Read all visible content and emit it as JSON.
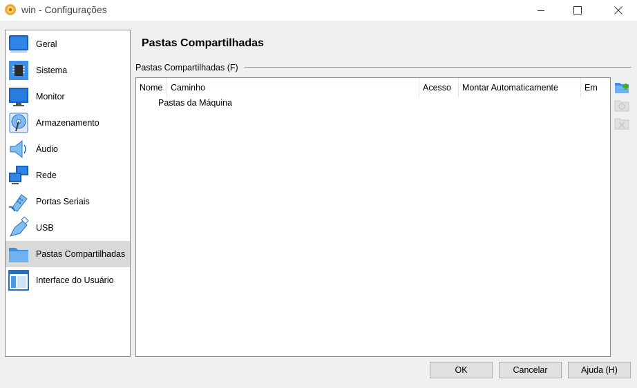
{
  "window": {
    "title": "win - Configurações"
  },
  "sidebar": {
    "items": [
      {
        "label": "Geral",
        "icon": "general-icon"
      },
      {
        "label": "Sistema",
        "icon": "system-chip-icon"
      },
      {
        "label": "Monitor",
        "icon": "monitor-icon"
      },
      {
        "label": "Armazenamento",
        "icon": "storage-disk-icon"
      },
      {
        "label": "Áudio",
        "icon": "speaker-icon"
      },
      {
        "label": "Rede",
        "icon": "network-icon"
      },
      {
        "label": "Portas Seriais",
        "icon": "serial-port-icon"
      },
      {
        "label": "USB",
        "icon": "usb-icon"
      },
      {
        "label": "Pastas Compartilhadas",
        "icon": "folder-icon",
        "selected": true
      },
      {
        "label": "Interface do Usuário",
        "icon": "user-interface-icon"
      }
    ]
  },
  "main": {
    "page_title": "Pastas Compartilhadas",
    "group_label": "Pastas Compartilhadas (F)",
    "table": {
      "columns": [
        "Nome",
        "Caminho",
        "Acesso",
        "Montar Automaticamente",
        "Em"
      ],
      "rows": [
        {
          "label": "Pastas da Máquina"
        }
      ]
    }
  },
  "buttons": {
    "ok": "OK",
    "cancel": "Cancelar",
    "help": "Ajuda (H)"
  },
  "colors": {
    "accent_blue": "#1e6fd9",
    "selected_bg": "#d9d9d9",
    "add_green": "#3fae29"
  }
}
